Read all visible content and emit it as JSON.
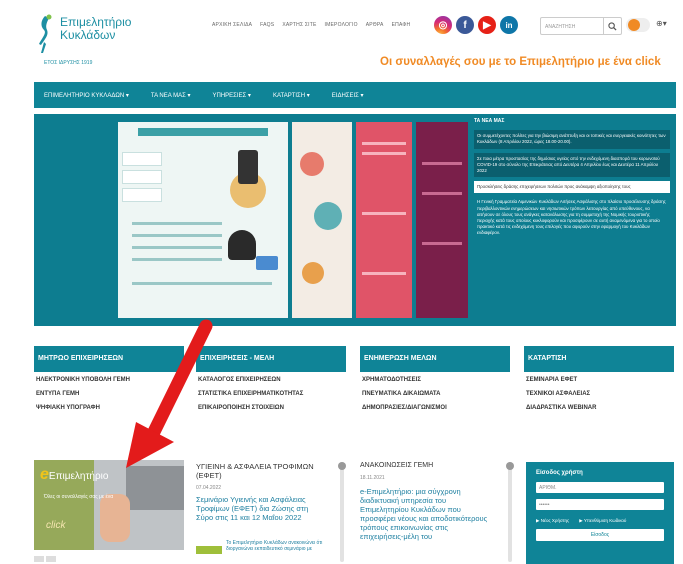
{
  "header": {
    "logo_line1": "Επιμελητήριο",
    "logo_line2": "Κυκλάδων",
    "logo_tagline": "ΕΤΟΣ ΙΔΡΥΣΗΣ 1919",
    "top_links": [
      "ΑΡΧΙΚΗ ΣΕΛΙΔΑ",
      "FAQS",
      "ΧΑΡΤΗΣ ΣΙΤΕ",
      "ΙΜΕΡΟΛΟΓΙΟ",
      "ΑΡΘΡΑ",
      "ΕΠΑΦΗ"
    ],
    "search_placeholder": "ΑΝΑΖΗΤΗΣΗ",
    "lang": "⊕▾",
    "slogan": "Οι συναλλαγές σου με το Επιμελητήριο με ένα click"
  },
  "nav": {
    "items": [
      "ΕΠΙΜΕΛΗΤΗΡΙΟ ΚΥΚΛΑΔΩΝ ▾",
      "ΤΑ ΝΕΑ ΜΑΣ ▾",
      "ΥΠΗΡΕΣΙΕΣ ▾",
      "ΚΑΤΑΡΤΙΣΗ ▾",
      "ΕΙΔΗΣΕΙΣ ▾"
    ]
  },
  "hero": {
    "news_title": "ΤΑ ΝΕΑ ΜΑΣ",
    "news_block1": "Οι συμμετέχοντες πολίτες για την βιώσιμη ανάπτυξη και οι τοπικές και ενεργειακές κοινότητες των Κυκλάδων (8 Απριλίου 2022, ώρες 18.00-20.00).",
    "news_block2": "Σε ποια μέτρα προστασίας της δημόσιας υγείας από την ενδεχόμενη διασπορά του κορωνοϊού COVID-19 στο σύνολο της Επικράτειας από Δευτέρα 4 Απριλίου έως και Δευτέρα 11 Απριλίου 2022",
    "news_white": "Προσκλήσεις δράσης επιχειρήσεων πολιτών προς ανάκαμψη αξιοποίησης τους",
    "news_text": "Η Γενική Γραμματεία Λιμενικών Κυκλάδων Αιτήσεις Ασφάλισης στο πλαίσιο προσέλευσης δράσης περιβαλλοντικών ενημερώσεων και νησιωτικών τρόπων λειτουργίας από υπεύθυνους, να αιτήσουν σε όλους τους ανάγκες κατανάλωσης για τη συμμετοχή της Νομικής τουριστικής περιοχής κατά τους οποίους κυκλοφορούν και προσφέρουν σε αυτή αναμενόμενα για το οποίο πρακτικό κατά τις ενδεχόμενη τους επιλογές που αφορούν στην εφαρμογή του Κυκλάδων ενδιαφέρον."
  },
  "categories": [
    {
      "head": "ΜΗΤΡΩΟ ΕΠΙΧΕΙΡΗΣΕΩΝ",
      "items": [
        "ΗΛΕΚΤΡΟΝΙΚΗ ΥΠΟΒΟΛΗ ΓΕΜΗ",
        "ΕΝΤΥΠΑ ΓΕΜΗ",
        "ΨΗΦΙΑΚΗ ΥΠΟΓΡΑΦΗ"
      ]
    },
    {
      "head": "ΕΠΙΧΕΙΡΗΣΕΙΣ - ΜΕΛΗ",
      "items": [
        "ΚΑΤΑΛΟΓΟΣ ΕΠΙΧΕΙΡΗΣΕΩΝ",
        "ΣΤΑΤΙΣΤΙΚΑ ΕΠΙΧΕΙΡΗΜΑΤΙΚΟΤΗΤΑΣ",
        "ΕΠΙΚΑΙΡΟΠΟΙΗΣΗ ΣΤΟΙΧΕΙΩΝ"
      ]
    },
    {
      "head": "ΕΝΗΜΕΡΩΣΗ ΜΕΛΩΝ",
      "items": [
        "ΧΡΗΜΑΤΟΔΟΤΗΣΕΙΣ",
        "ΠΝΕΥΜΑΤΙΚΑ ΔΙΚΑΙΩΜΑΤΑ",
        "ΔΗΜΟΠΡΑΣΙΕΣ/ΔΙΑΓΩΝΙΣΜΟΙ"
      ]
    },
    {
      "head": "ΚΑΤΑΡΤΙΣΗ",
      "items": [
        "ΣΕΜΙΝΑΡΙΑ ΕΦΕΤ",
        "ΤΕΧΝΙΚΟΙ ΑΣΦΑΛΕΙΑΣ",
        "ΔΙΑΔΡΑΣΤΙΚΑ WEBINAR"
      ]
    }
  ],
  "promo": {
    "brand_e": "e",
    "brand": "Επιμελητήριο",
    "small": "Όλες οι συναλλαγές σας με ένα",
    "click": "click"
  },
  "food_news": {
    "heading": "ΥΓΙΕΙΝΗ & ΑΣΦΑΛΕΙΑ ΤΡΟΦΙΜΩΝ (ΕΦΕΤ)",
    "date": "07.04.2022",
    "link": "Σεμινάριο Υγιεινής και Ασφάλειας Τροφίμων (ΕΦΕΤ) δια Ζώσης στη Σύρο στις 11 και 12 Μαΐου 2022",
    "excerpt": "Το Επιμελητήριο Κυκλάδων ανακοινώνει ότι διοργανώνει εκπαιδευτικό σεμινάριο με"
  },
  "gemi_news": {
    "heading": "ΑΝΑΚΟΙΝΩΣΕΙΣ ΓΕΜΗ",
    "date": "18.11.2021",
    "link": "e-Επιμελητήριο: μια σύγχρονη διαδικτυακή υπηρεσία του Επιμελητηρίου Κυκλάδων που προσφέρει νέους και αποδοτικότερους τρόπους επικοινωνίας στις επιχειρήσεις-μέλη του"
  },
  "login": {
    "title": "Είσοδος χρήστη",
    "user_placeholder": "ΑΡΙΘΜ.",
    "pass_placeholder": "••••••",
    "link1": "▶ Νέος Χρήστης",
    "link2": "▶ Υπενθύμιση Κωδικού",
    "button": "Είσοδος"
  },
  "colors": {
    "teal": "#0f8497",
    "orange": "#f08a24",
    "arrow": "#e31b1b"
  }
}
